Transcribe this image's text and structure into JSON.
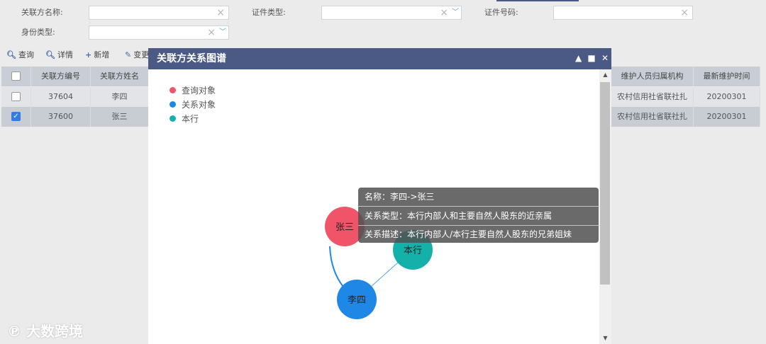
{
  "search": {
    "party_name_label": "关联方名称:",
    "cert_type_label": "证件类型:",
    "cert_no_label": "证件号码:",
    "id_type_label": "身份类型:",
    "party_name_value": "",
    "cert_type_value": "",
    "cert_no_value": "",
    "id_type_value": ""
  },
  "toolbar": {
    "query_label": "查询",
    "detail_label": "详情",
    "add_label": "新增",
    "change_label": "变更"
  },
  "grid": {
    "headers": [
      "关联方编号",
      "关联方姓名",
      "维护人员归属机构",
      "最新维护时间"
    ],
    "rows": [
      {
        "checked": false,
        "id": "37604",
        "name": "李四",
        "org": "农村信用社省联社扎",
        "time": "20200301"
      },
      {
        "checked": true,
        "id": "37600",
        "name": "张三",
        "org": "农村信用社省联社扎",
        "time": "20200301"
      }
    ]
  },
  "modal": {
    "title": "关联方关系图谱",
    "legend": [
      {
        "label": "查询对象",
        "color": "#ef5468"
      },
      {
        "label": "关系对象",
        "color": "#1f87e6"
      },
      {
        "label": "本行",
        "color": "#14b1ab"
      }
    ],
    "nodes": {
      "zhangsan": {
        "label": "张三",
        "color": "#ef5468"
      },
      "lisi": {
        "label": "李四",
        "color": "#1f87e6"
      },
      "benhang": {
        "label": "本行",
        "color": "#14b1ab"
      }
    },
    "tooltip": {
      "name_line": "名称：李四->张三",
      "type_line": "关系类型：本行内部人和主要自然人股东的近亲属",
      "desc_line": "关系描述：本行内部人/本行主要自然人股东的兄弟姐妹"
    }
  },
  "watermark": "大数跨境"
}
